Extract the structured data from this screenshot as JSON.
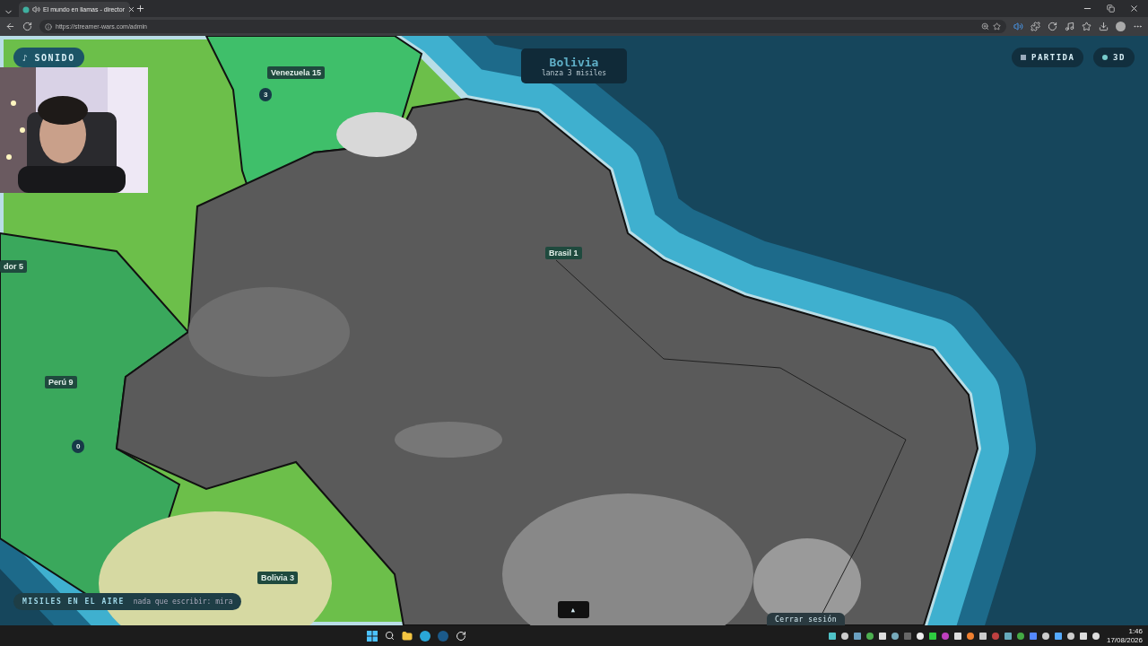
{
  "browser": {
    "tab": {
      "title": "El mundo en llamas - director",
      "audio_playing": true
    },
    "url": "https://streamer-wars.com/admin"
  },
  "hud": {
    "sound_button": {
      "icon": "♪",
      "label": "SONIDO"
    },
    "event": {
      "title": "Bolivia",
      "subtitle": "lanza 3 misiles"
    },
    "buttons": [
      {
        "label": "PARTIDA",
        "kind": "square"
      },
      {
        "label": "3D",
        "kind": "dot"
      }
    ],
    "ticker": {
      "label": "MISILES EN EL AIRE",
      "text": "nada que escribir: mira"
    },
    "expand_button": "▲",
    "logout": "Cerrar sesión"
  },
  "map": {
    "labels": [
      {
        "text": "Venezuela 15"
      },
      {
        "text": "dor 5"
      },
      {
        "text": "Brasil 1"
      },
      {
        "text": "Perú 9"
      },
      {
        "text": "Bolivia 3"
      }
    ],
    "markers": [
      {
        "text": "3"
      },
      {
        "text": "0"
      }
    ]
  },
  "taskbar": {
    "time": "1:46",
    "date": "17/08/2026"
  }
}
